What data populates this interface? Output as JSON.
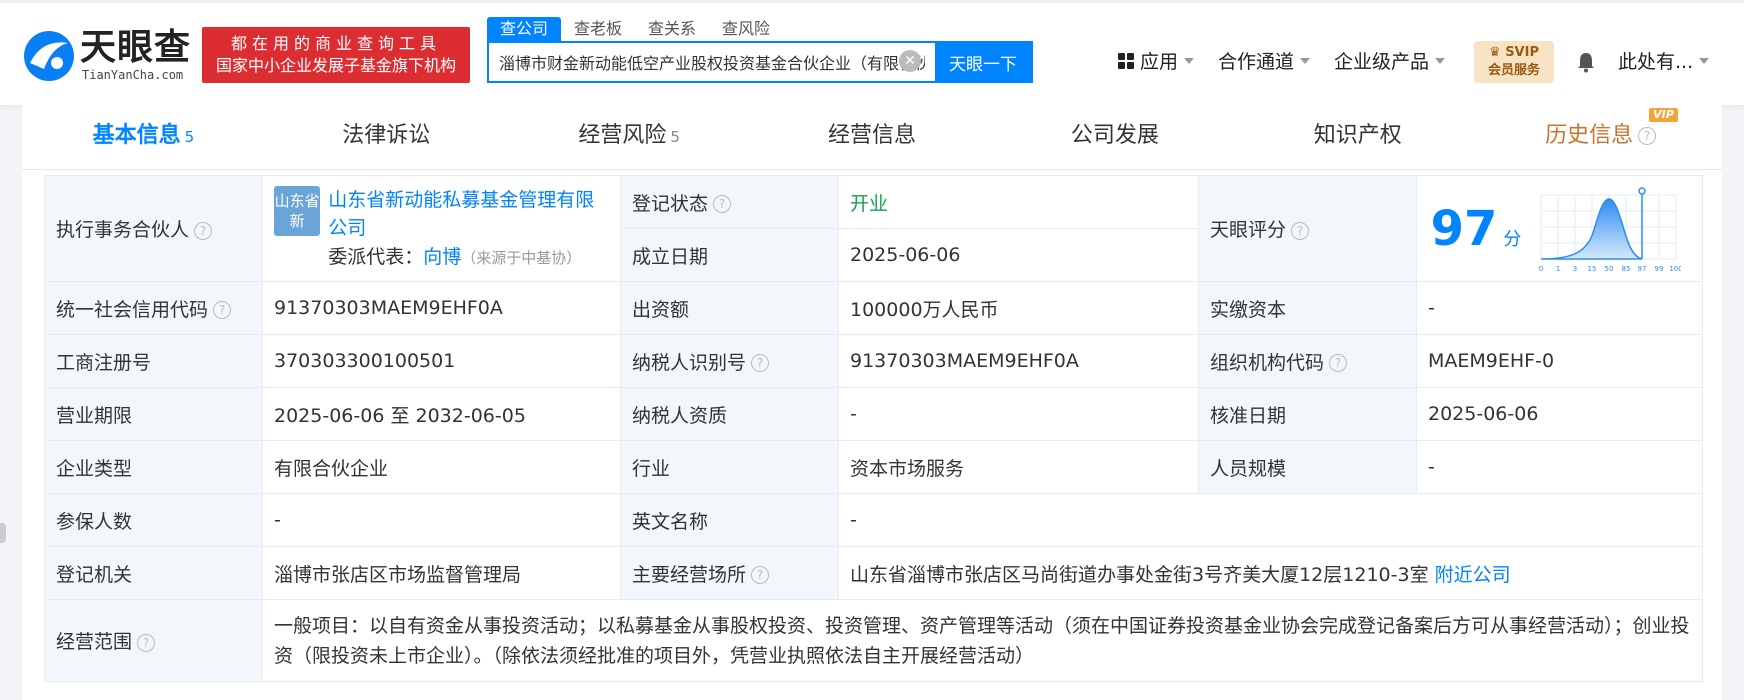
{
  "header": {
    "logo_text": "天眼查",
    "logo_sub": "TianYanCha.com",
    "slogan_line1": "都在用的商业查询工具",
    "slogan_line2": "国家中小企业发展子基金旗下机构",
    "search_tabs": [
      "查公司",
      "查老板",
      "查关系",
      "查风险"
    ],
    "search_value": "淄博市财金新动能低空产业股权投资基金合伙企业（有限合伙）",
    "search_button": "天眼一下",
    "nav": [
      "应用",
      "合作通道",
      "企业级产品"
    ],
    "svip_line1": "SVIP",
    "svip_line2": "会员服务",
    "user": "此处有..."
  },
  "tabs": [
    {
      "label": "基本信息",
      "count": "5"
    },
    {
      "label": "法律诉讼",
      "count": ""
    },
    {
      "label": "经营风险",
      "count": "5"
    },
    {
      "label": "经营信息",
      "count": ""
    },
    {
      "label": "公司发展",
      "count": ""
    },
    {
      "label": "知识产权",
      "count": ""
    },
    {
      "label": "历史信息",
      "count": ""
    }
  ],
  "vip_badge": "VIP",
  "info": {
    "partner_label": "执行事务合伙人",
    "partner_logo": "山东省新",
    "partner_name": "山东省新动能私募基金管理有限公司",
    "rep_label": "委派代表：",
    "rep_name": "向博",
    "rep_source": "（来源于中基协）",
    "status_label": "登记状态",
    "status_value": "开业",
    "found_label": "成立日期",
    "found_value": "2025-06-06",
    "score_label": "天眼评分",
    "score_value": "97",
    "score_unit": "分",
    "score_ticks": [
      "0",
      "1",
      "3",
      "15",
      "50",
      "85",
      "97",
      "99",
      "100"
    ],
    "credit_label": "统一社会信用代码",
    "credit_value": "91370303MAEM9EHF0A",
    "capital_label": "出资额",
    "capital_value": "100000万人民币",
    "paid_label": "实缴资本",
    "paid_value": "-",
    "reg_label": "工商注册号",
    "reg_value": "370303300100501",
    "tax_label": "纳税人识别号",
    "tax_value": "91370303MAEM9EHF0A",
    "org_label": "组织机构代码",
    "org_value": "MAEM9EHF-0",
    "term_label": "营业期限",
    "term_value": "2025-06-06 至 2032-06-05",
    "taxq_label": "纳税人资质",
    "taxq_value": "-",
    "approve_label": "核准日期",
    "approve_value": "2025-06-06",
    "type_label": "企业类型",
    "type_value": "有限合伙企业",
    "industry_label": "行业",
    "industry_value": "资本市场服务",
    "staff_label": "人员规模",
    "staff_value": "-",
    "insured_label": "参保人数",
    "insured_value": "-",
    "en_label": "英文名称",
    "en_value": "-",
    "authority_label": "登记机关",
    "authority_value": "淄博市张店区市场监督管理局",
    "address_label": "主要经营场所",
    "address_value": "山东省淄博市张店区马尚街道办事处金街3号齐美大厦12层1210-3室",
    "nearby_link": "附近公司",
    "scope_label": "经营范围",
    "scope_value": "一般项目：以自有资金从事投资活动；以私募基金从事股权投资、投资管理、资产管理等活动（须在中国证券投资基金业协会完成登记备案后方可从事经营活动）；创业投资（限投资未上市企业）。（除依法须经批准的项目外，凭营业执照依法自主开展经营活动）"
  }
}
